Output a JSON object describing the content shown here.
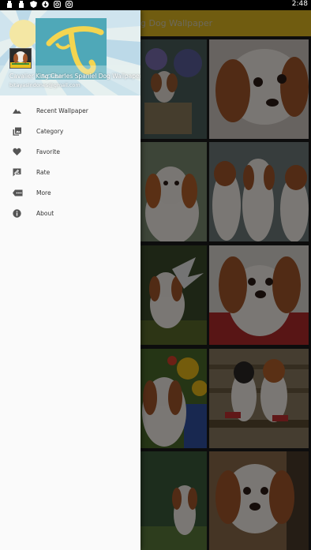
{
  "status_bar": {
    "time": "2:48",
    "icons": [
      "notification-icon",
      "notification-icon",
      "shield-icon",
      "download-icon",
      "instagram-icon",
      "instagram-icon"
    ]
  },
  "app_bar": {
    "title_partial": "g Dog Wallpaper",
    "color": "#e0b820"
  },
  "drawer": {
    "header": {
      "app_name": "Cavalier King Charles Spaniel Dog Wallpaper",
      "email": "bitayasindones@gmail.com",
      "logo_text": "BeGuitar"
    },
    "items": [
      {
        "label": "Recent Wallpaper",
        "icon": "landscape-icon"
      },
      {
        "label": "Category",
        "icon": "photo-library-icon"
      },
      {
        "label": "Favorite",
        "icon": "heart-icon"
      },
      {
        "label": "Rate",
        "icon": "rate-review-icon"
      },
      {
        "label": "More",
        "icon": "more-icon"
      },
      {
        "label": "About",
        "icon": "info-icon"
      }
    ]
  }
}
